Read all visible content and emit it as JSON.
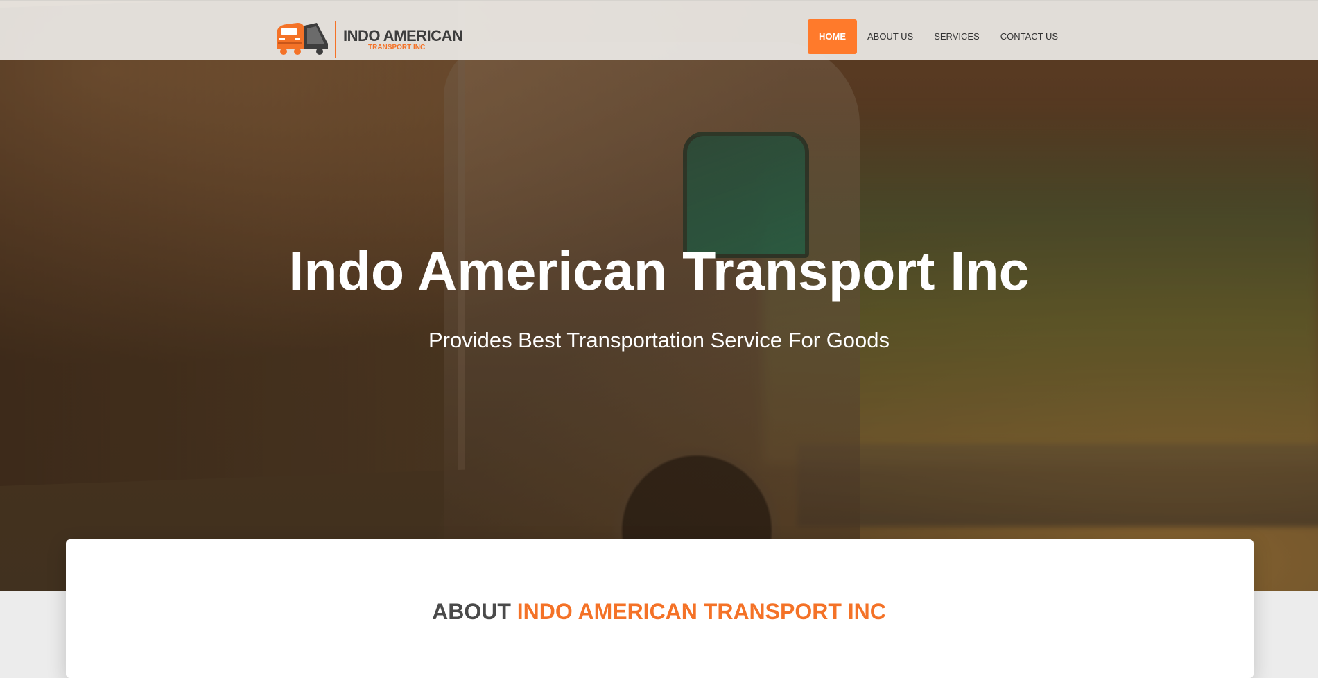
{
  "brand": {
    "name": "INDO AMERICAN",
    "tagline": "TRANSPORT INC",
    "accent_color": "#f47227"
  },
  "nav": {
    "items": [
      {
        "label": "HOME",
        "active": true
      },
      {
        "label": "ABOUT US",
        "active": false
      },
      {
        "label": "SERVICES",
        "active": false
      },
      {
        "label": "CONTACT US",
        "active": false
      }
    ]
  },
  "hero": {
    "title": "Indo American Transport Inc",
    "subtitle": "Provides Best Transportation Service For Goods"
  },
  "about": {
    "heading_prefix": "ABOUT ",
    "heading_accent": "INDO AMERICAN TRANSPORT INC"
  }
}
